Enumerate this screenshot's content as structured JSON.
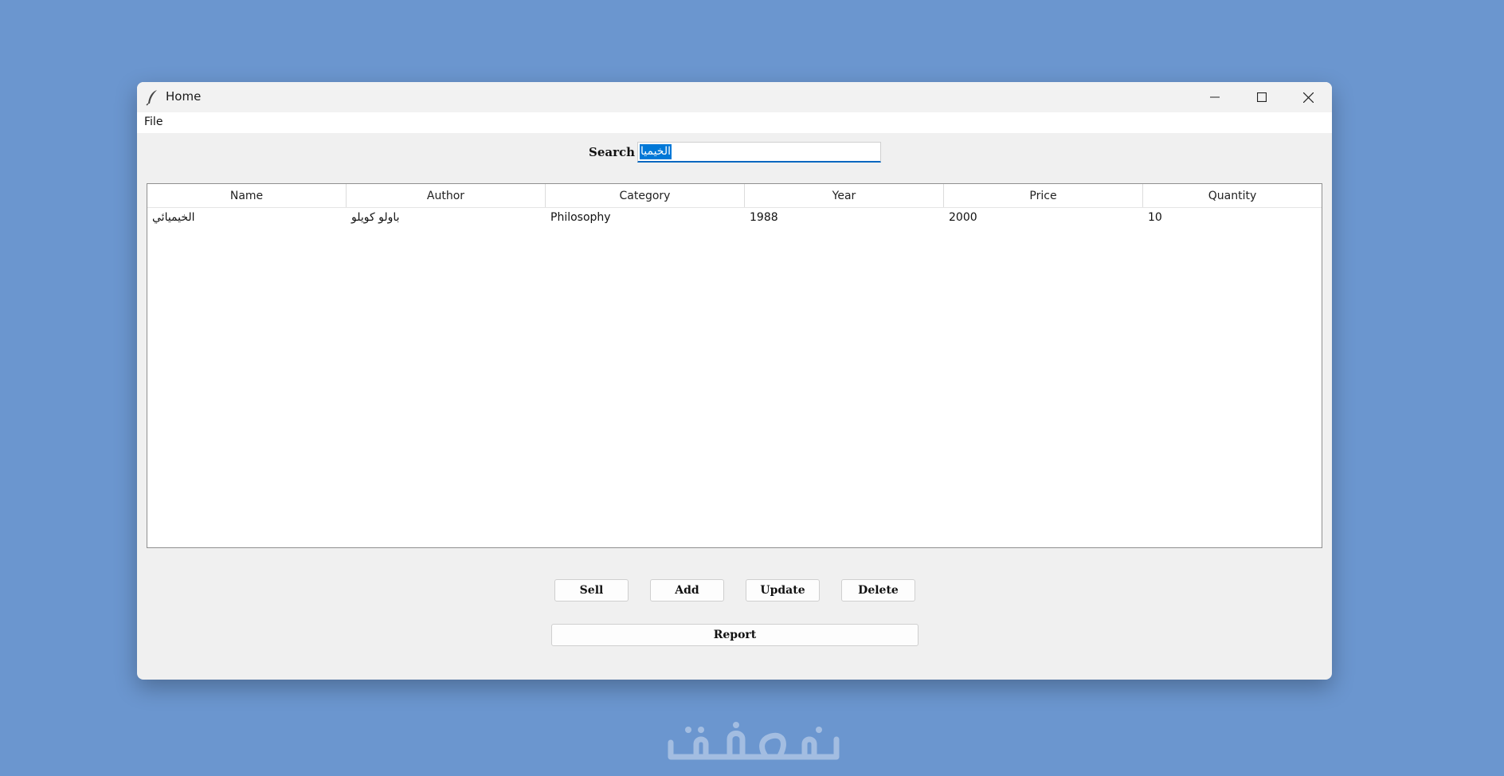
{
  "window": {
    "title": "Home",
    "icon": "feather-icon"
  },
  "menu": {
    "file_label": "File"
  },
  "search": {
    "label": "Search",
    "value": "الخيميا"
  },
  "table": {
    "columns": [
      "Name",
      "Author",
      "Category",
      "Year",
      "Price",
      "Quantity"
    ],
    "rows": [
      [
        "الخيميائي",
        "باولو كويلو",
        "Philosophy",
        "1988",
        "2000",
        "10"
      ]
    ]
  },
  "buttons": {
    "sell": "Sell",
    "add": "Add",
    "update": "Update",
    "delete": "Delete",
    "report": "Report"
  },
  "colors": {
    "desktop": "#6b96cf",
    "selection": "#0078d7",
    "focus_underline": "#0067c0"
  }
}
